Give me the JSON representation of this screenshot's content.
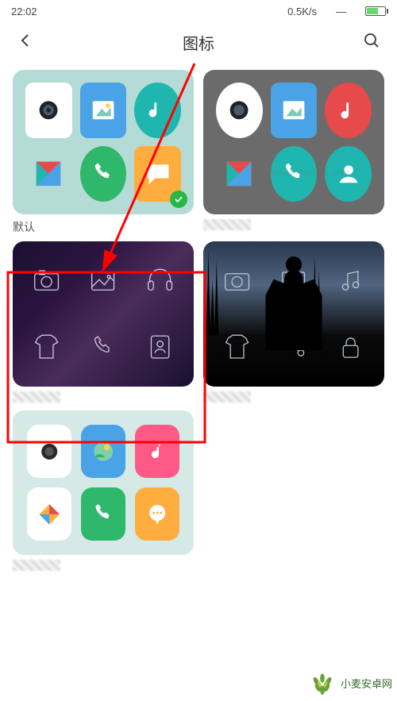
{
  "status": {
    "time": "22:02",
    "net_speed": "0.5K/s"
  },
  "header": {
    "title": "图标"
  },
  "themes": [
    {
      "id": "default",
      "label": "默认",
      "selected": true
    },
    {
      "id": "gray",
      "label": ""
    },
    {
      "id": "dark1",
      "label": ""
    },
    {
      "id": "dark2",
      "label": ""
    },
    {
      "id": "rounded",
      "label": ""
    }
  ],
  "colors": {
    "teal": "#1fb6b0",
    "sky": "#4aa3e6",
    "red": "#e64a4a",
    "green": "#2fb86b",
    "orange": "#ffad3f",
    "yellow": "#ffd24a",
    "pink": "#ff5a87",
    "badge": "#27b845"
  },
  "watermark_top": "www.xmsigma.com",
  "watermark_bottom": "小麦安卓网"
}
